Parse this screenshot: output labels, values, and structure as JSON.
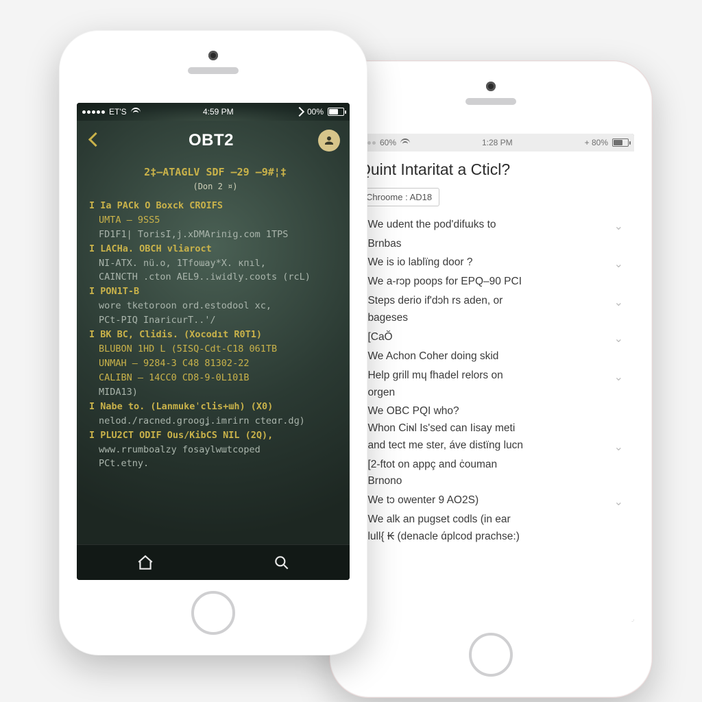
{
  "phoneA": {
    "status": {
      "carrier": "ET'S",
      "time": "4:59 PM",
      "battery_pct": "00%",
      "signal_on": 5
    },
    "header": {
      "title": "OBT2"
    },
    "code": {
      "heading": "2‡—ATAGLV SDF –29 –9#¦‡",
      "subheading": "(Don 2 ¤)",
      "lines": [
        {
          "cls": "sec",
          "text": "I Ia PACk  O Boxck CROIFS"
        },
        {
          "cls": "key indent",
          "text": "UMTA – 9SS5"
        },
        {
          "cls": "dim indent",
          "text": "FD1F1|  TorisI,j.xDMAriпiɡ.com 1TPS"
        },
        {
          "cls": "sec",
          "text": "I LACHa. OBCH vliaroct"
        },
        {
          "cls": "dim indent",
          "text": "NI‑ATX.  nü.o, 1Tfoɯay*X. кпıl,"
        },
        {
          "cls": "dim indent",
          "text": "CAINCTH .cton AEL9..iwidly.coots (rсL)"
        },
        {
          "cls": "sec",
          "text": "I PON1T‑B"
        },
        {
          "cls": "dim indent",
          "text": "worе tketoroon ord.estodool xc,"
        },
        {
          "cls": "dim indent",
          "text": "PCt‑PIQ InaricurT..'/"
        },
        {
          "cls": "sec",
          "text": "I BK BC, Clidis. (Xocodıt R0T1)"
        },
        {
          "cls": "key indent",
          "text": "BLUBON 1HD L (5ISQ‑Cdt‑C18 061TB"
        },
        {
          "cls": "key indent",
          "text": "UNMAH – 9284‑3 C48 81302‑22"
        },
        {
          "cls": "key indent",
          "text": "CALIBN – 14CC0  CD8‑9‑0L101B"
        },
        {
          "cls": "dim indent",
          "text": "МIDA13)"
        },
        {
          "cls": "sec",
          "text": "I Nabe to.  (Lanmukeˈclis+ɯh) (X0)"
        },
        {
          "cls": "dim indent",
          "text": "nelod./racned.grooɡʝ.imrirn cteɑr.dɡ)"
        },
        {
          "cls": "sec",
          "text": "I PLU2CT ODIF Ous/KibCS NIL (2Q),"
        },
        {
          "cls": "dim indent",
          "text": "www.rrumboalzy fosaylwɯtcoped"
        },
        {
          "cls": "dim indent",
          "text": "PCt.etny."
        }
      ]
    },
    "tabbar": {
      "home": "home",
      "search": "search"
    }
  },
  "phoneB": {
    "status": {
      "carrier": "60%",
      "time": "1:28 PM",
      "right": "+ 80%"
    },
    "title": "Quint Intaritat a Cticl?",
    "chip": "Chroome : AD18",
    "faq": [
      {
        "text": "We udent the pod'difɯks to",
        "chev": true
      },
      {
        "text": "Brnbas",
        "chev": false
      },
      {
        "text": "We is io lablïng door ?",
        "chev": true
      },
      {
        "text": "We а‑rɔp poops for EPQ–90 PCI",
        "chev": false
      },
      {
        "text": "Steps derio if'dɔh rs aden, or",
        "chev": true
      },
      {
        "text": "bageses",
        "chev": false,
        "cont": true
      },
      {
        "text": "[CaŎ",
        "chev": true
      },
      {
        "text": "We Achon Coher doing skid",
        "chev": false
      },
      {
        "text": "Help grill mɥ fhadel relors on",
        "chev": true
      },
      {
        "text": "orgen",
        "chev": false,
        "cont": true
      },
      {
        "text": "We OBC PQI who?",
        "chev": false
      },
      {
        "text": "Whon Сiɴl Is'sed can Iisay meti",
        "chev": false,
        "cont": true
      },
      {
        "text": "and tect me ster, áve distïng lucn",
        "chev": true,
        "cont": true
      },
      {
        "text": "[2‑ftot on appç and ċouman",
        "chev": false
      },
      {
        "text": "Brnono",
        "chev": false,
        "cont": true
      },
      {
        "text": "We tɔ owenter 9 AO2S)",
        "chev": true
      },
      {
        "text": "We alk an puɡset codls (in ear",
        "chev": false
      },
      {
        "text": "lull{ ₭ (denacle ɑ́рlcоd prachse:)",
        "chev": false,
        "cont": true
      }
    ]
  }
}
